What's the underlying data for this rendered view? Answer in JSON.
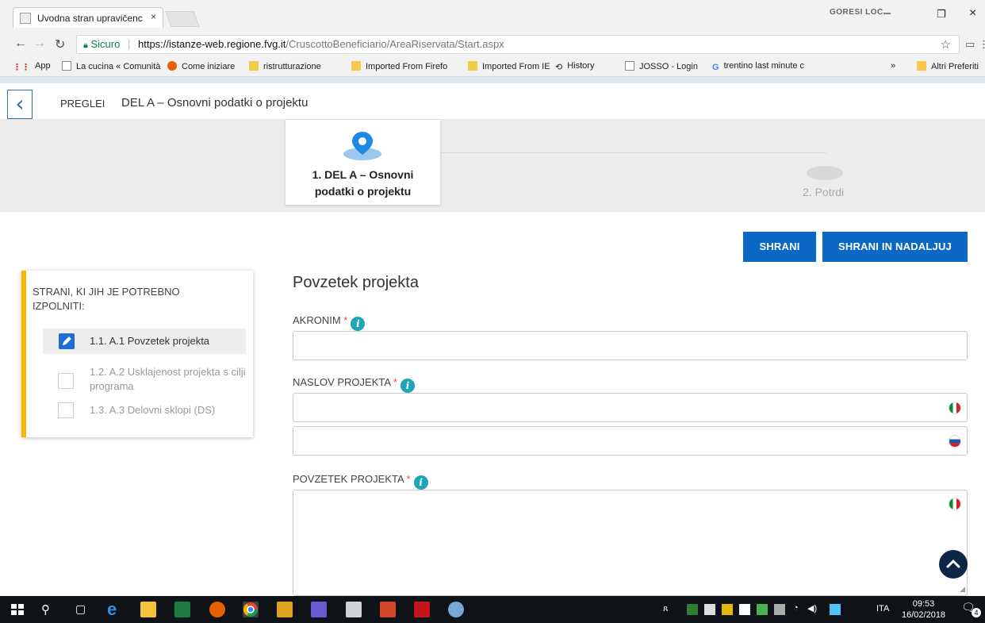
{
  "browser": {
    "tab_title": "Uvodna stran upravičenc",
    "tab_close": "×",
    "profile_name": "GORESI LOC",
    "window_controls": [
      "–",
      "❐",
      "×"
    ],
    "secure_label": "Sicuro",
    "url_host": "https://istanze-web.regione.fvg.it",
    "url_path": "/CruscottoBeneficiario/AreaRiservata/Start.aspx",
    "bookmarks": [
      {
        "label": "App",
        "icon": "apps-icon"
      },
      {
        "label": "La cucina « Comunità",
        "icon": "page-icon"
      },
      {
        "label": "Come iniziare",
        "icon": "firefox-icon"
      },
      {
        "label": "ristrutturazione",
        "icon": "folder-icon"
      },
      {
        "label": "Imported From Firefo",
        "icon": "folder-icon"
      },
      {
        "label": "Imported From IE",
        "icon": "folder-icon"
      },
      {
        "label": "History",
        "icon": "history-icon"
      },
      {
        "label": "JOSSO - Login",
        "icon": "page-icon"
      },
      {
        "label": "trentino last minute c",
        "icon": "google-icon"
      },
      {
        "label": "»",
        "icon": ""
      },
      {
        "label": "Altri Preferiti",
        "icon": "folder-icon"
      }
    ]
  },
  "page": {
    "breadcrumb_root": "PREGLEI",
    "breadcrumb_current": "DEL A – Osnovni podatki o projektu",
    "steps": [
      {
        "label_line1": "1. DEL A – Osnovni",
        "label_line2": "podatki o projektu",
        "active": true
      },
      {
        "label": "2. Potrdi",
        "active": false
      }
    ],
    "save_button": "SHRANI",
    "save_continue_button": "SHRANI IN NADALJUJ",
    "panel": {
      "title": "STRANI, KI JIH JE POTREBNO IZPOLNITI:",
      "items": [
        {
          "label": "1.1. A.1 Povzetek projekta",
          "state": "active"
        },
        {
          "label": "1.2. A.2 Usklajenost projekta s cilji programa",
          "state": "pending"
        },
        {
          "label": "1.3. A.3 Delovni sklopi (DS)",
          "state": "pending"
        }
      ]
    },
    "form": {
      "heading": "Povzetek projekta",
      "fields": [
        {
          "label": "AKRONIM",
          "required_mark": "*",
          "value": ""
        },
        {
          "label": "NASLOV PROJEKTA",
          "required_mark": "*",
          "value_it": "",
          "value_si": ""
        },
        {
          "label": "POVZETEK PROJEKTA",
          "required_mark": "*",
          "value_it": ""
        }
      ]
    }
  },
  "taskbar": {
    "language": "ITA",
    "time": "09:53",
    "date": "16/02/2018",
    "notifications_count": "4"
  },
  "colors": {
    "primary_blue": "#0b68c4",
    "accent_yellow": "#f5b800",
    "info_teal": "#1fa5b8",
    "pin_blue": "#1e88e5"
  }
}
